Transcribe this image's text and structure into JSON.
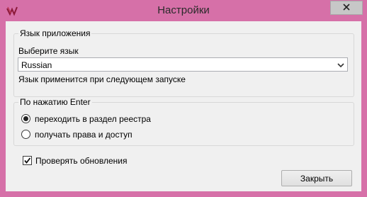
{
  "window": {
    "title": "Настройки",
    "app_icon": "app-logo-icon",
    "close_icon": "close-icon"
  },
  "language_group": {
    "legend": "Язык приложения",
    "prompt": "Выберите язык",
    "selected_language": "Russian",
    "hint": "Язык применится при следующем запуске"
  },
  "enter_group": {
    "legend": "По нажатию Enter",
    "options": [
      {
        "label": "переходить в раздел реестра",
        "checked": true
      },
      {
        "label": "получать права и доступ",
        "checked": false
      }
    ]
  },
  "check_updates": {
    "label": "Проверять обновления",
    "checked": true
  },
  "close_button": {
    "label": "Закрыть"
  },
  "colors": {
    "frame": "#d670a8",
    "client_bg": "#f0f0f0",
    "group_border": "#d8d8d8"
  }
}
